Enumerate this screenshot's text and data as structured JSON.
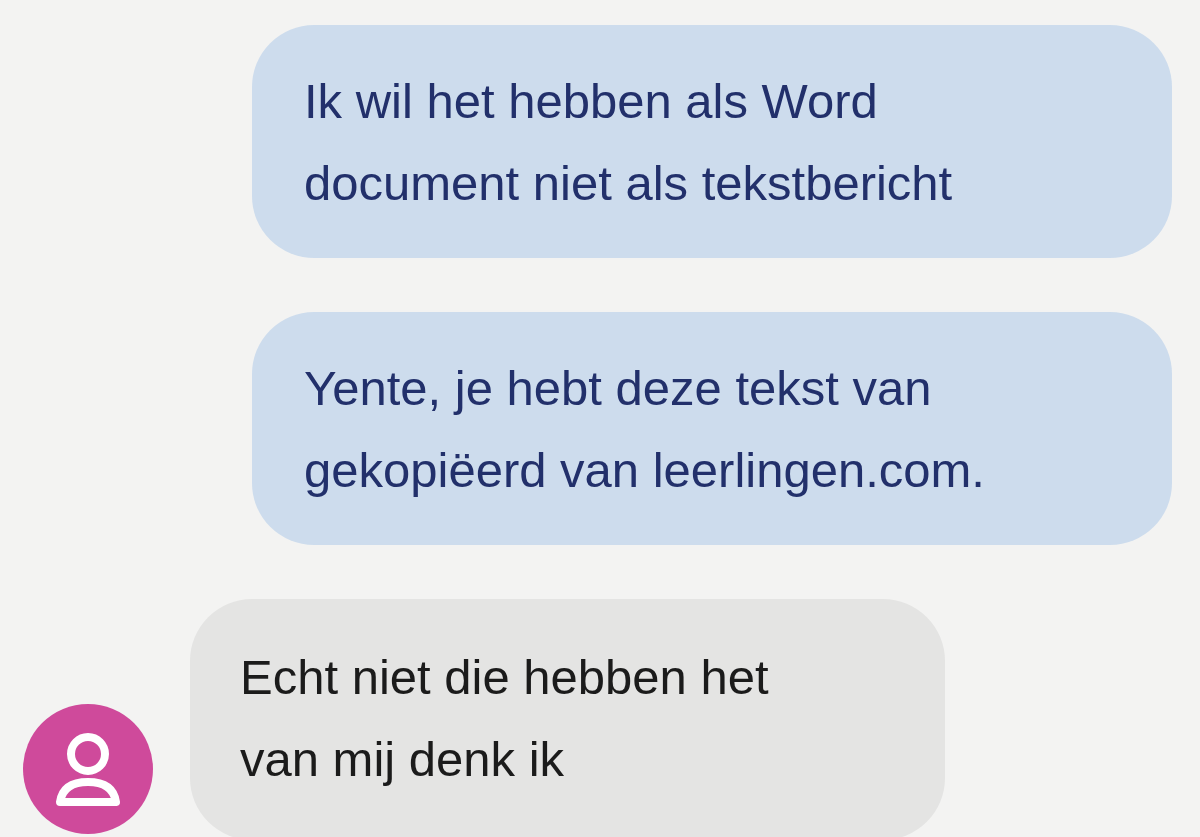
{
  "messages": [
    {
      "kind": "outgoing",
      "text": "Ik wil het hebben als Word document niet als tekstbericht"
    },
    {
      "kind": "outgoing",
      "text": "Yente, je hebt deze tekst van gekopiëerd van leerlingen.com."
    },
    {
      "kind": "incoming",
      "text": "Echt niet die hebben het van mij denk ik"
    }
  ]
}
